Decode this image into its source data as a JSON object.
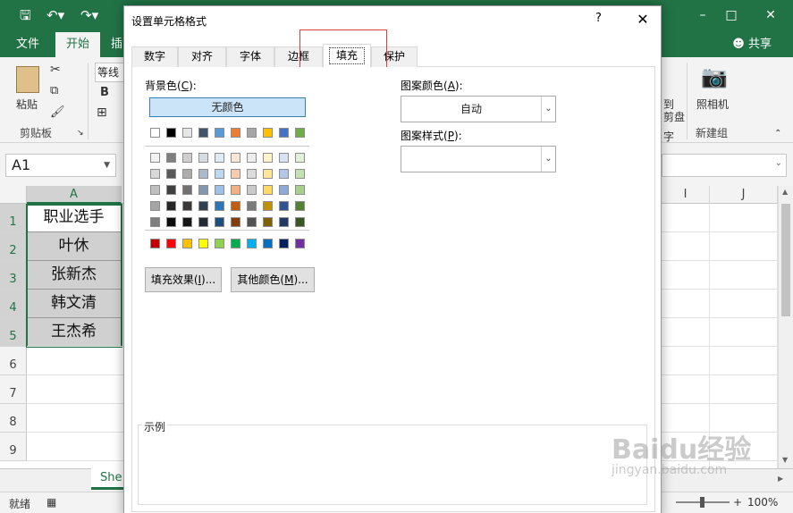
{
  "excel": {
    "qat": {
      "save_icon": "save-icon",
      "undo_icon": "undo-icon",
      "redo_icon": "redo-icon"
    },
    "tabs": [
      "文件",
      "开始",
      "插"
    ],
    "share_label": "共享",
    "ribbon": {
      "paste_label": "粘贴",
      "clipboard_group": "剪贴板",
      "font_name": "等线",
      "bold": "B",
      "camera_label": "照相机",
      "new_group": "新建组",
      "partial_dao": "到",
      "partial_pan": "剪盘",
      "partial_zi": "字"
    },
    "name_box": "A1",
    "columns": [
      "A",
      "I",
      "J"
    ],
    "rows": [
      "1",
      "2",
      "3",
      "4",
      "5",
      "6",
      "7",
      "8",
      "9"
    ],
    "cells": [
      "职业选手",
      "叶休",
      "张新杰",
      "韩文清",
      "王杰希"
    ],
    "sheet_tab": "She",
    "status": {
      "ready": "就绪",
      "zoom": "100%"
    }
  },
  "dialog": {
    "title": "设置单元格格式",
    "help": "?",
    "close": "✕",
    "tabs": [
      "数字",
      "对齐",
      "字体",
      "边框",
      "填充",
      "保护"
    ],
    "active_tab": "填充",
    "bg_color_label": "背景色(",
    "bg_color_key": "C",
    "bg_color_suffix": "):",
    "no_color": "无颜色",
    "fill_effects": "填充效果(",
    "fill_effects_key": "I",
    "fill_effects_suffix": ")...",
    "more_colors": "其他颜色(",
    "more_colors_key": "M",
    "more_colors_suffix": ")...",
    "pattern_color_label": "图案颜色(",
    "pattern_color_key": "A",
    "pattern_color_suffix": "):",
    "pattern_color_value": "自动",
    "pattern_style_label": "图案样式(",
    "pattern_style_key": "P",
    "pattern_style_suffix": "):",
    "pattern_style_value": "",
    "sample_label": "示例",
    "palette": {
      "base": [
        "#ffffff",
        "#000000",
        "#e7e6e6",
        "#44546a",
        "#5b9bd5",
        "#ed7d31",
        "#a5a5a5",
        "#ffc000",
        "#4472c4",
        "#70ad47"
      ],
      "tints": [
        [
          "#f2f2f2",
          "#7f7f7f",
          "#d0cece",
          "#d6dce4",
          "#deebf6",
          "#fbe5d5",
          "#ededed",
          "#fff2cc",
          "#d9e2f3",
          "#e2efd9"
        ],
        [
          "#d8d8d8",
          "#595959",
          "#aeabab",
          "#adb9ca",
          "#bdd7ee",
          "#f7cbac",
          "#dbdbdb",
          "#fee599",
          "#b4c6e7",
          "#c5e0b3"
        ],
        [
          "#bfbfbf",
          "#3f3f3f",
          "#757070",
          "#8496b0",
          "#9cc3e5",
          "#f4b083",
          "#c9c9c9",
          "#ffd966",
          "#8eaadb",
          "#a8d08d"
        ],
        [
          "#a5a5a5",
          "#262626",
          "#3a3838",
          "#323f4f",
          "#2e75b5",
          "#c55a11",
          "#7b7b7b",
          "#bf9000",
          "#2f5496",
          "#538135"
        ],
        [
          "#7f7f7f",
          "#0c0c0c",
          "#171616",
          "#222a35",
          "#1e4e79",
          "#833c0b",
          "#525252",
          "#7f6000",
          "#1f3864",
          "#375623"
        ]
      ],
      "standard": [
        "#c00000",
        "#ff0000",
        "#ffc000",
        "#ffff00",
        "#92d050",
        "#00b050",
        "#00b0f0",
        "#0070c0",
        "#002060",
        "#7030a0"
      ]
    }
  },
  "watermark": {
    "main": "Baidu经验",
    "sub": "jingyan.baidu.com"
  }
}
